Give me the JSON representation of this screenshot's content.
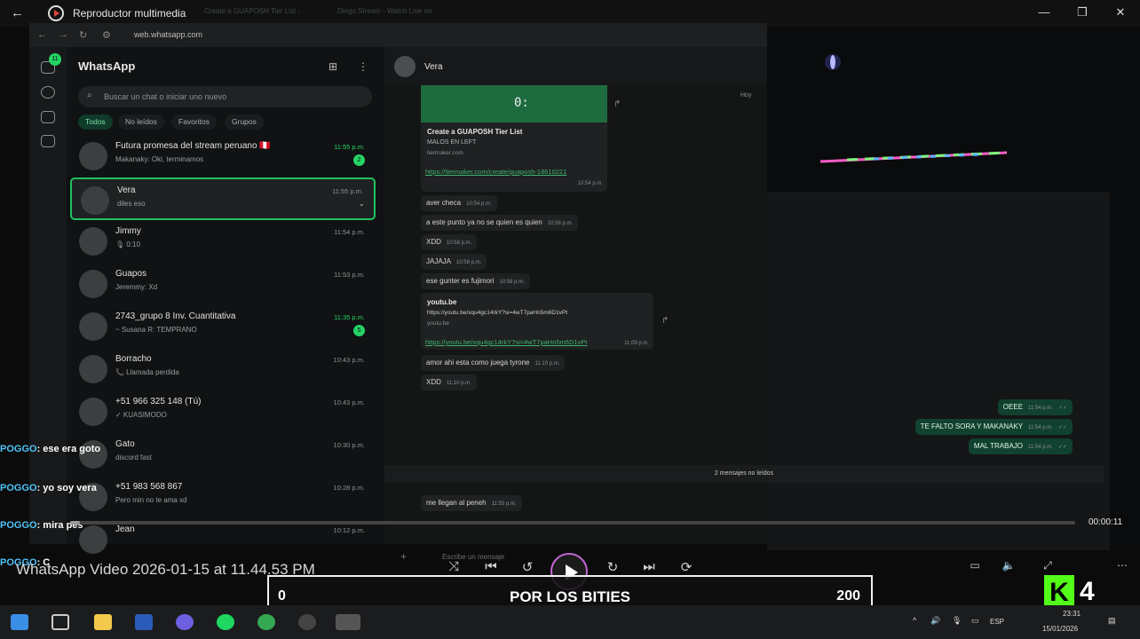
{
  "player": {
    "title": "Reproductor multimedia",
    "ghost_tabs": [
      "Create a GUAPOSH Tier List -",
      "Diego Stream - Watch Live on"
    ],
    "video_title": "WhatsApp Video 2026-01-15 at 11.44.53 PM",
    "elapsed": "00:00:11",
    "progress": 0.01
  },
  "browser": {
    "url": "web.whatsapp.com"
  },
  "whatsapp": {
    "title": "WhatsApp",
    "rail_badge": "11",
    "search_placeholder": "Buscar un chat o iniciar uno nuevo",
    "filters": [
      "Todos",
      "No leídos",
      "Favoritos",
      "Grupos"
    ],
    "chats": [
      {
        "name": "Futura promesa del stream peruano 🇵🇪",
        "preview": "Makanaky: Oki, terminamos",
        "time": "11:55 p.m.",
        "unread": "2",
        "green": true
      },
      {
        "name": "Vera",
        "preview": "diles eso",
        "time": "11:55 p.m.",
        "selected": true
      },
      {
        "name": "Jimmy",
        "preview": "🎙 0:10",
        "time": "11:54 p.m."
      },
      {
        "name": "Guapos",
        "preview": "Jeremmy: Xd",
        "time": "11:53 p.m."
      },
      {
        "name": "2743_grupo 8 Inv. Cuantitativa",
        "preview": "~ Susana R: TEMPRANO",
        "time": "11:35 p.m.",
        "unread": "5",
        "green": true
      },
      {
        "name": "Borracho",
        "preview": "📞 Llamada perdida",
        "time": "10:43 p.m."
      },
      {
        "name": "+51 966 325 148 (Tú)",
        "preview": "✓ KUASIMODO",
        "time": "10:43 p.m."
      },
      {
        "name": "Gato",
        "preview": "discord fast",
        "time": "10:30 p.m."
      },
      {
        "name": "+51 983 568 867",
        "preview": "Pero min no te ama xd",
        "time": "10:28 p.m."
      },
      {
        "name": "Jean",
        "preview": "",
        "time": "10:12 p.m."
      }
    ]
  },
  "conversation": {
    "contact": "Vera",
    "day": "Hoy",
    "link_card": {
      "title": "Create a GUAPOSH Tier List",
      "subtitle": "MALOS EN LEFT",
      "domain": "tiermaker.com",
      "url": "https://tiermaker.com/create/guaposh-18610221",
      "time": "10:54 p.m."
    },
    "messages_in": [
      {
        "text": "aver checa",
        "time": "10:54 p.m."
      },
      {
        "text": "a este punto ya no se quien es quien",
        "time": "10:58 p.m."
      },
      {
        "text": "XDD",
        "time": "10:58 p.m."
      },
      {
        "text": "JAJAJA",
        "time": "10:58 p.m."
      },
      {
        "text": "ese gunter es fujimori",
        "time": "10:58 p.m."
      }
    ],
    "yt_card": {
      "title": "youtu.be",
      "sub": "https://youtu.be/xqu4gc14rkY?si=4wT7paHn5m6D1vPt",
      "domain": "youtu.be",
      "url": "https://youtu.be/xqu4gc14rkY?si=4wT7paHn5m6D1vPt",
      "time": "11:09 p.m."
    },
    "messages_in2": [
      {
        "text": "amor ahi esta como juega tyrone",
        "time": "11:10 p.m."
      },
      {
        "text": "XDD",
        "time": "11:10 p.m."
      }
    ],
    "messages_out": [
      {
        "text": "OEEE",
        "time": "11:54 p.m."
      },
      {
        "text": "TE FALTO SORA Y MAKANAKY",
        "time": "11:54 p.m."
      },
      {
        "text": "MAL TRABAJO",
        "time": "11:54 p.m."
      }
    ],
    "unread_divider": "2 mensajes no leídos",
    "last_in": {
      "text": "me llegan al peneh",
      "time": "11:55 p.m."
    },
    "compose_placeholder": "Escribe un mensaje"
  },
  "stream_chat": [
    {
      "user": "POGGO",
      "text": ": ese era goto"
    },
    {
      "user": "POGGO",
      "text": ": yo soy vera"
    },
    {
      "user": "POGGO",
      "text": ": mira pes"
    },
    {
      "user": "POGGO",
      "text": ": C"
    }
  ],
  "scoreboard": {
    "left": "0",
    "center": "POR LOS BITIES",
    "right": "200"
  },
  "brand": {
    "k": "K",
    "num": "4"
  },
  "tray": {
    "lang": "ESP",
    "time": "23:31",
    "date": "15/01/2026"
  }
}
